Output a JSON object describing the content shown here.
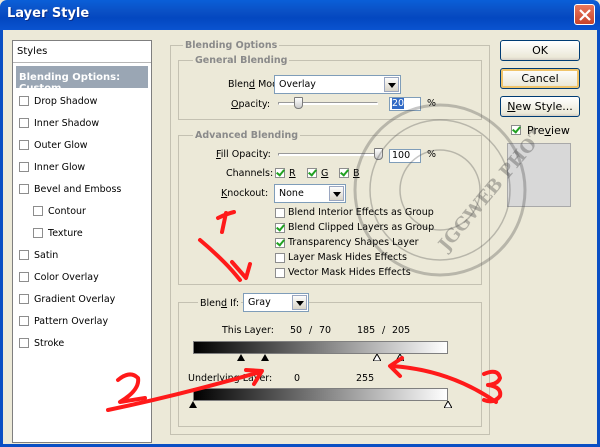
{
  "window": {
    "title": "Layer Style"
  },
  "styles_panel": {
    "header": "Styles",
    "active": "Blending Options: Custom",
    "items": [
      {
        "label": "Drop Shadow",
        "checked": false,
        "indent": false
      },
      {
        "label": "Inner Shadow",
        "checked": false,
        "indent": false
      },
      {
        "label": "Outer Glow",
        "checked": false,
        "indent": false
      },
      {
        "label": "Inner Glow",
        "checked": false,
        "indent": false
      },
      {
        "label": "Bevel and Emboss",
        "checked": false,
        "indent": false
      },
      {
        "label": "Contour",
        "checked": false,
        "indent": true
      },
      {
        "label": "Texture",
        "checked": false,
        "indent": true
      },
      {
        "label": "Satin",
        "checked": false,
        "indent": false
      },
      {
        "label": "Color Overlay",
        "checked": false,
        "indent": false
      },
      {
        "label": "Gradient Overlay",
        "checked": false,
        "indent": false
      },
      {
        "label": "Pattern Overlay",
        "checked": false,
        "indent": false
      },
      {
        "label": "Stroke",
        "checked": false,
        "indent": false
      }
    ]
  },
  "blending": {
    "section_title": "Blending Options",
    "general_title": "General Blending",
    "blend_mode_label": "Blend Mode:",
    "blend_mode_value": "Overlay",
    "opacity_label": "Opacity:",
    "opacity_value": "20",
    "opacity_unit": "%",
    "opacity_fraction": 0.2,
    "advanced_title": "Advanced Blending",
    "fill_opacity_label": "Fill Opacity:",
    "fill_opacity_value": "100",
    "fill_opacity_unit": "%",
    "fill_opacity_fraction": 1.0,
    "channels_label": "Channels:",
    "channels": [
      {
        "label": "R",
        "checked": true
      },
      {
        "label": "G",
        "checked": true
      },
      {
        "label": "B",
        "checked": true
      }
    ],
    "knockout_label": "Knockout:",
    "knockout_value": "None",
    "options": [
      {
        "label": "Blend Interior Effects as Group",
        "checked": false
      },
      {
        "label": "Blend Clipped Layers as Group",
        "checked": true
      },
      {
        "label": "Transparency Shapes Layer",
        "checked": true
      },
      {
        "label": "Layer Mask Hides Effects",
        "checked": false
      },
      {
        "label": "Vector Mask Hides Effects",
        "checked": false
      }
    ],
    "blend_if_label": "Blend If:",
    "blend_if_value": "Gray",
    "this_layer_label": "This Layer:",
    "this_layer_values": [
      "50",
      "/",
      "70",
      "185",
      "/",
      "205"
    ],
    "underlying_label": "Underlying Layer:",
    "underlying_values": [
      "0",
      "255"
    ]
  },
  "buttons": {
    "ok": "OK",
    "cancel": "Cancel",
    "new_style": "New Style...",
    "preview_label": "Preview",
    "preview_checked": true
  },
  "watermark": {
    "text": "JGGWEB PHOTO & RETOUCH"
  },
  "annotations": [
    "1",
    "2",
    "3"
  ]
}
